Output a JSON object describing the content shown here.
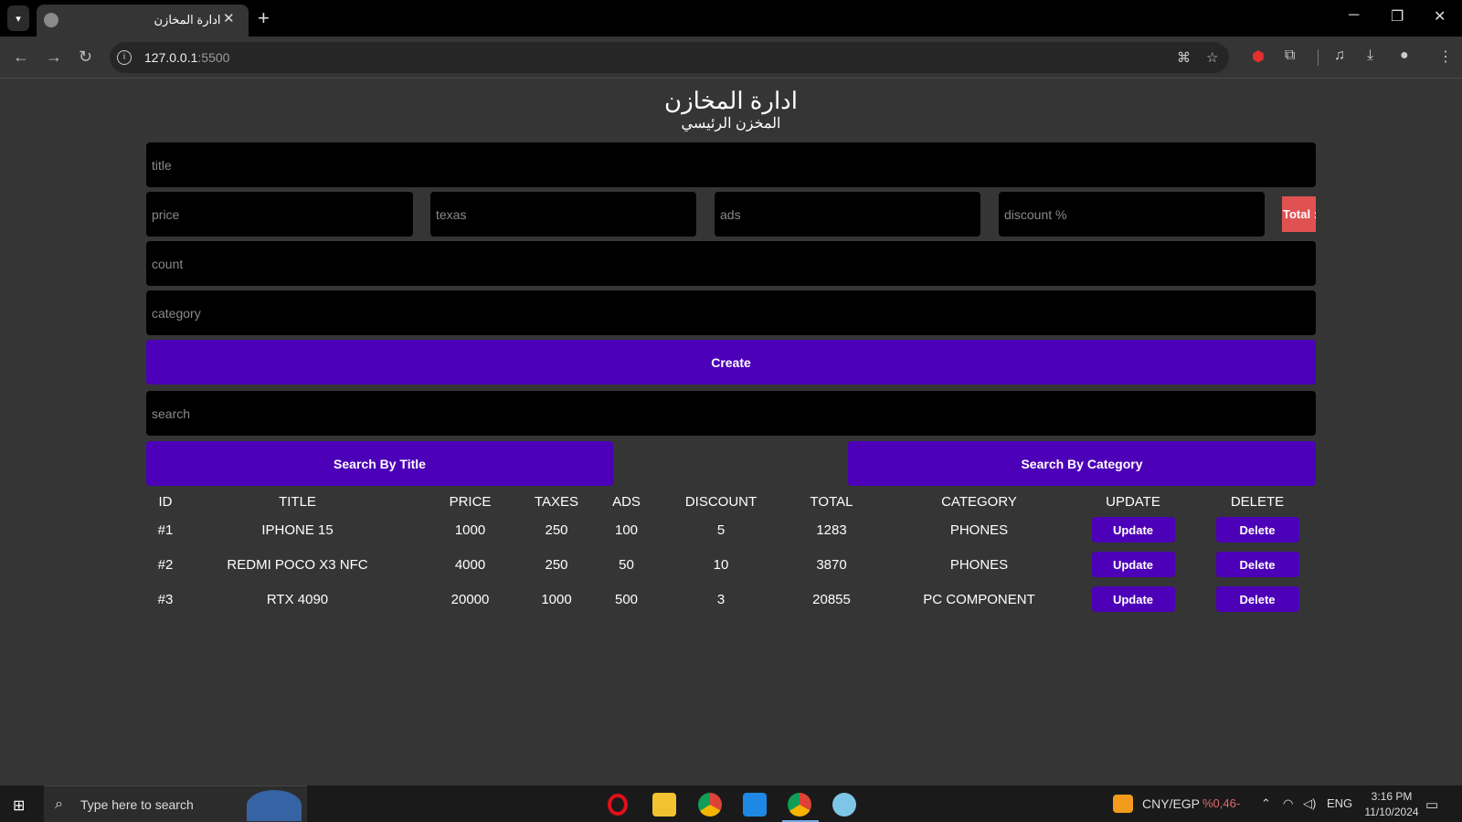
{
  "browser": {
    "tab_title": "ادارة المخازن",
    "url_host": "127.0.0.1",
    "url_port": ":5500"
  },
  "page": {
    "heading": "ادارة المخازن",
    "subheading": "المخزن الرئيسي"
  },
  "form": {
    "title_placeholder": "title",
    "price_placeholder": "price",
    "taxes_placeholder": "texas",
    "ads_placeholder": "ads",
    "discount_placeholder": "discount %",
    "total_label": "Total :",
    "count_placeholder": "count",
    "category_placeholder": "category",
    "create_label": "Create",
    "search_placeholder": "search",
    "search_title_label": "Search By Title",
    "search_category_label": "Search By Category"
  },
  "table": {
    "headers": [
      "ID",
      "TITLE",
      "PRICE",
      "TAXES",
      "ADS",
      "DISCOUNT",
      "TOTAL",
      "CATEGORY",
      "UPDATE",
      "DELETE"
    ],
    "rows": [
      {
        "id": "#1",
        "title": "IPHONE 15",
        "price": "1000",
        "taxes": "250",
        "ads": "100",
        "discount": "5",
        "total": "1283",
        "category": "PHONES",
        "update": "Update",
        "delete": "Delete"
      },
      {
        "id": "#2",
        "title": "REDMI POCO X3 NFC",
        "price": "4000",
        "taxes": "250",
        "ads": "50",
        "discount": "10",
        "total": "3870",
        "category": "PHONES",
        "update": "Update",
        "delete": "Delete"
      },
      {
        "id": "#3",
        "title": "RTX 4090",
        "price": "20000",
        "taxes": "1000",
        "ads": "500",
        "discount": "3",
        "total": "20855",
        "category": "PC COMPONENT",
        "update": "Update",
        "delete": "Delete"
      }
    ]
  },
  "taskbar": {
    "search_text": "Type here to search",
    "currency": "CNY/EGP",
    "currency_change": "%0,46-",
    "language": "ENG",
    "time": "3:16 PM",
    "date": "11/10/2024"
  },
  "colors": {
    "accent": "#4c00b8",
    "total_bg": "#e05252",
    "page_bg": "#353535"
  }
}
